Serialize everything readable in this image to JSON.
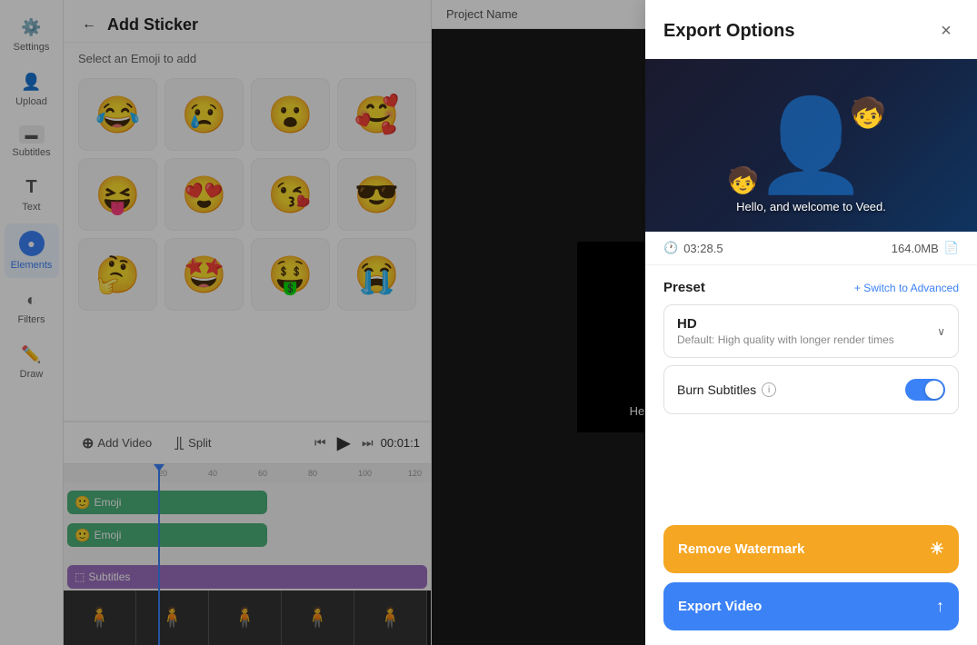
{
  "sidebar": {
    "items": [
      {
        "id": "settings",
        "label": "Settings",
        "icon": "⚙",
        "active": false
      },
      {
        "id": "upload",
        "label": "Upload",
        "icon": "👤",
        "active": false
      },
      {
        "id": "subtitles",
        "label": "Subtitles",
        "icon": "▬",
        "active": false
      },
      {
        "id": "text",
        "label": "Text",
        "icon": "T",
        "active": false
      },
      {
        "id": "elements",
        "label": "Elements",
        "icon": "●",
        "active": true
      },
      {
        "id": "filters",
        "label": "Filters",
        "icon": "◐",
        "active": false
      },
      {
        "id": "draw",
        "label": "Draw",
        "icon": "✏",
        "active": false
      }
    ]
  },
  "sticker_panel": {
    "title": "Add Sticker",
    "subtitle": "Select an Emoji to add",
    "back_label": "←",
    "emojis": [
      "😂",
      "😢",
      "😮",
      "🥰",
      "😝",
      "😍",
      "😘",
      "😎",
      "🤔",
      "🤩",
      "🤑",
      "😭"
    ]
  },
  "project": {
    "name": "Project Name"
  },
  "video_preview": {
    "subtitle_text": "Hello, and welcome to Veed."
  },
  "timeline_controls": {
    "add_video_label": "Add Video",
    "split_label": "Split",
    "time_display": "00:01:1",
    "play_icon": "▶",
    "prev_icon": "⏮",
    "next_icon": "⏭"
  },
  "timeline": {
    "ruler_marks": [
      "20",
      "40",
      "60",
      "80",
      "100",
      "120"
    ],
    "tracks": [
      {
        "label": "Emoji",
        "type": "emoji"
      },
      {
        "label": "Emoji",
        "type": "emoji"
      }
    ],
    "subtitle_track_label": "Subtitles"
  },
  "export_panel": {
    "title": "Export Options",
    "close_icon": "×",
    "duration": "03:28.5",
    "file_size": "164.0MB",
    "clock_icon": "🕐",
    "file_icon": "📄",
    "preset_label": "Preset",
    "switch_advanced_label": "+ Switch to Advanced",
    "preset_name": "HD",
    "preset_description": "Default: High quality with longer render times",
    "chevron_icon": "∨",
    "burn_subtitles_label": "Burn Subtitles",
    "burn_subtitles_info": "i",
    "burn_subtitles_enabled": true,
    "remove_watermark_label": "Remove Watermark",
    "export_video_label": "Export Video",
    "watermark_icon": "☀",
    "export_icon": "↑",
    "preview_text": "Hello, and welcome to Veed."
  }
}
